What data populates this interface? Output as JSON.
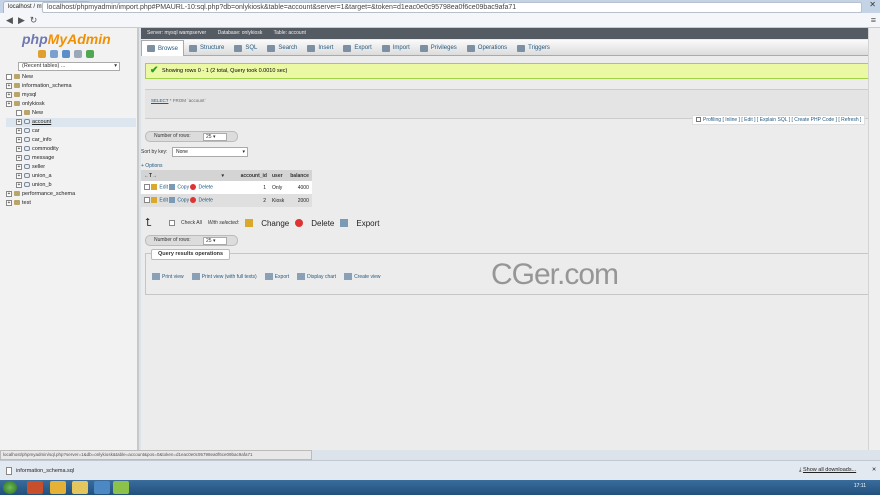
{
  "browser": {
    "tab_title": "localhost / mysql wampor",
    "tab_close": "×",
    "url": "localhost/phpmyadmin/import.php#PMAURL-10:sql.php?db=onlykiosk&table=account&server=1&target=&token=d1eac0e0c95798ea0f6ce09bac9afa71",
    "window_controls": [
      "–",
      "□",
      "✕"
    ],
    "menu_icon": "≡"
  },
  "sidebar": {
    "logo_php": "php",
    "logo_my": "MyAdmin",
    "recent_tables": "(Recent tables) ...",
    "tree": [
      {
        "label": "New",
        "type": "new",
        "indent": 0
      },
      {
        "label": "information_schema",
        "type": "db",
        "indent": 0
      },
      {
        "label": "mysql",
        "type": "db",
        "indent": 0
      },
      {
        "label": "onlykiosk",
        "type": "db",
        "indent": 0
      },
      {
        "label": "New",
        "type": "new",
        "indent": 1
      },
      {
        "label": "account",
        "type": "table",
        "indent": 1,
        "selected": true
      },
      {
        "label": "car",
        "type": "table",
        "indent": 1
      },
      {
        "label": "car_info",
        "type": "table",
        "indent": 1
      },
      {
        "label": "commodity",
        "type": "table",
        "indent": 1
      },
      {
        "label": "message",
        "type": "table",
        "indent": 1
      },
      {
        "label": "seller",
        "type": "table",
        "indent": 1
      },
      {
        "label": "union_a",
        "type": "table",
        "indent": 1
      },
      {
        "label": "union_b",
        "type": "table",
        "indent": 1
      },
      {
        "label": "performance_schema",
        "type": "db",
        "indent": 0
      },
      {
        "label": "test",
        "type": "db",
        "indent": 0
      }
    ]
  },
  "breadcrumb": {
    "server": "Server: mysql wampserver",
    "database": "Database: onlykiosk",
    "table": "Table: account"
  },
  "tabs": [
    "Browse",
    "Structure",
    "SQL",
    "Search",
    "Insert",
    "Export",
    "Import",
    "Privileges",
    "Operations",
    "Triggers"
  ],
  "message": "Showing rows 0 - 1 (2 total, Query took 0.0010 sec)",
  "sql": {
    "select": "SELECT",
    "rest": "* FROM `account`"
  },
  "sql_links": "Profiling [ Inline ] [ Edit ] [ Explain SQL ] [ Create PHP Code ] [ Refresh ]",
  "number_of_rows_label": "Number of rows:",
  "number_of_rows_value": "25",
  "sort_by_label": "Sort by key:",
  "sort_by_value": "None",
  "options_label": "+ Options",
  "table": {
    "columns": [
      "account_id",
      "user",
      "balance"
    ],
    "actions": {
      "edit": "Edit",
      "copy": "Copy",
      "delete": "Delete"
    },
    "rows": [
      {
        "account_id": "1",
        "user": "Only",
        "balance": "4000"
      },
      {
        "account_id": "2",
        "user": "Kiosk",
        "balance": "2000"
      }
    ]
  },
  "bulk": {
    "check_all": "Check All",
    "with_selected": "With selected:",
    "change": "Change",
    "delete": "Delete",
    "export": "Export"
  },
  "query_results": {
    "legend": "Query results operations",
    "links": [
      "Print view",
      "Print view (with full texts)",
      "Export",
      "Display chart",
      "Create view"
    ]
  },
  "watermark": "CGer.com",
  "status_url": "localhost/phpmyadmin/sql.php?server=1&db=onlykiosk&table=account&pos=0&token=d1eac0e0c95798ea0f6ce09bac9afa71",
  "download": {
    "file": "information_schema.sql",
    "show_all": "Show all downloads..."
  },
  "clock": "17:11",
  "colors": {
    "accent": "#235a81",
    "success_bg": "#ebf8a4",
    "logo_php": "#6f79b0",
    "logo_myadmin": "#f29000"
  }
}
